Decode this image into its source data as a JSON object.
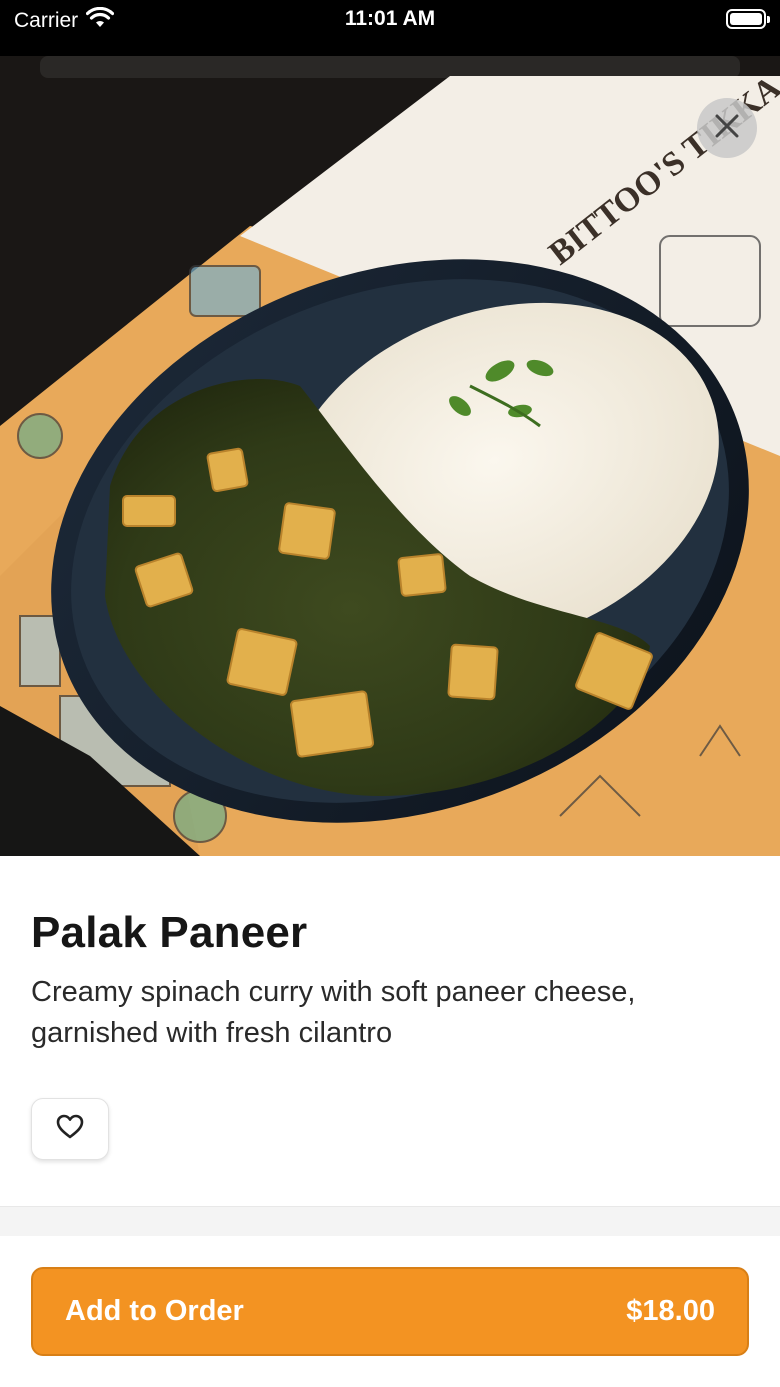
{
  "status_bar": {
    "carrier": "Carrier",
    "time": "11:01 AM"
  },
  "hero": {
    "image_subject": "palak paneer with rice in a dark bowl on an illustrated placemat",
    "menu_brand_text": "BITTOO'S TIKKA"
  },
  "dish": {
    "name": "Palak Paneer",
    "description": "Creamy spinach curry with soft paneer cheese, garnished with fresh cilantro"
  },
  "actions": {
    "favorite_icon": "heart-outline-icon",
    "close_icon": "close-icon",
    "add_label": "Add to Order",
    "price": "$18.00"
  },
  "colors": {
    "accent": "#f39322",
    "text_primary": "#161616",
    "text_secondary": "#2a2a2a"
  }
}
